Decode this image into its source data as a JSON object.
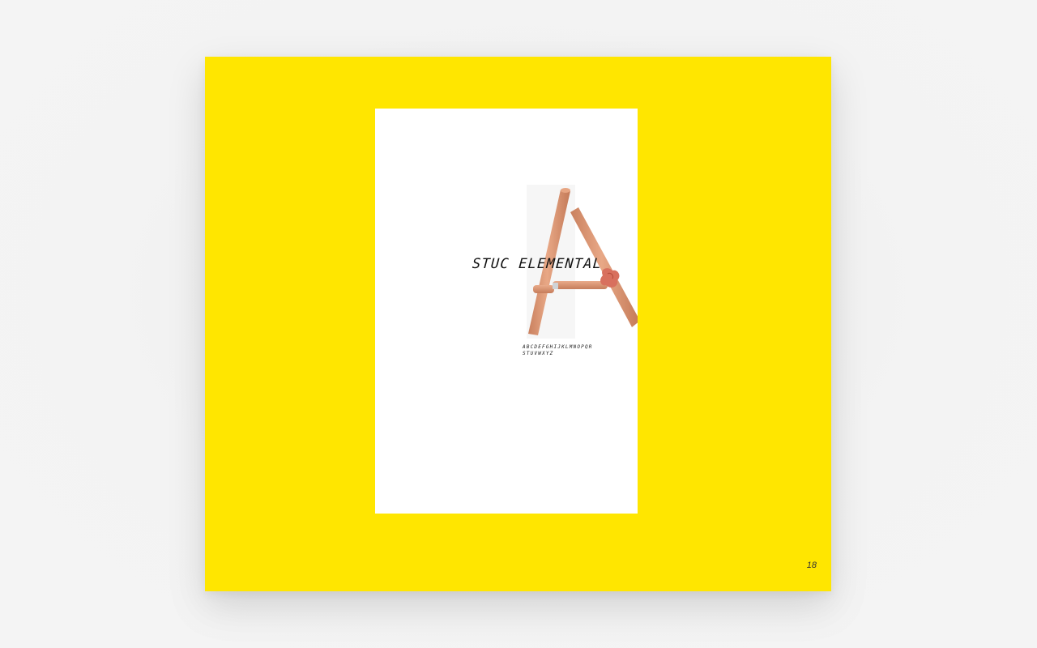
{
  "spread": {
    "background_color": "#FFE600",
    "page_number": "18"
  },
  "card": {
    "title": "STUC ELEMENTAL",
    "alphabet_line_1": "ABCDEFGHIJKLMNOPQR",
    "alphabet_line_2": "STUVWXYZ",
    "stick_color": "#D9926F",
    "joint_color": "#D87060"
  }
}
